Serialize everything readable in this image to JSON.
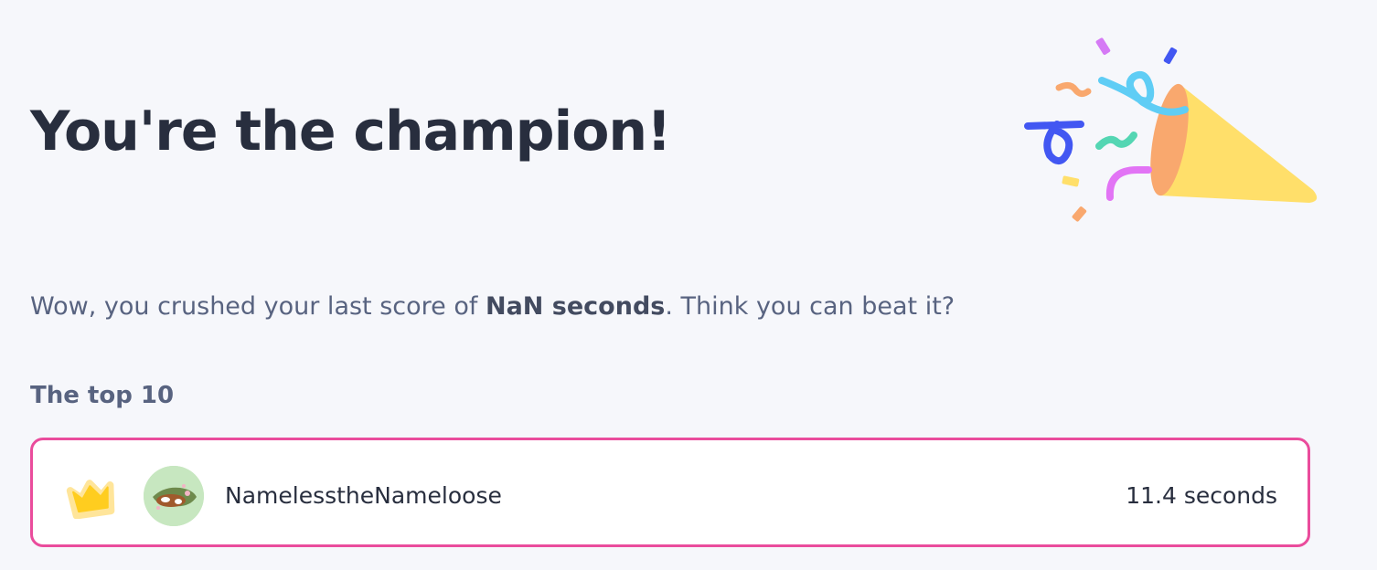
{
  "header": {
    "title": "You're the champion!"
  },
  "message": {
    "prefix": "Wow, you crushed your last score of ",
    "highlight": "NaN seconds",
    "suffix": ". Think you can beat it?"
  },
  "leaderboard": {
    "heading": "The top 10",
    "rows": [
      {
        "rank_icon": "crown-icon",
        "avatar": "user-avatar",
        "username": "NamelesstheNameloose",
        "score": "11.4 seconds"
      }
    ]
  },
  "decorations": {
    "party_icon": "party-popper-icon"
  },
  "colors": {
    "background": "#f6f7fb",
    "title": "#282e3e",
    "body_text": "#586380",
    "highlight_border": "#ea4c9c",
    "crown": "#ffcd1f"
  }
}
